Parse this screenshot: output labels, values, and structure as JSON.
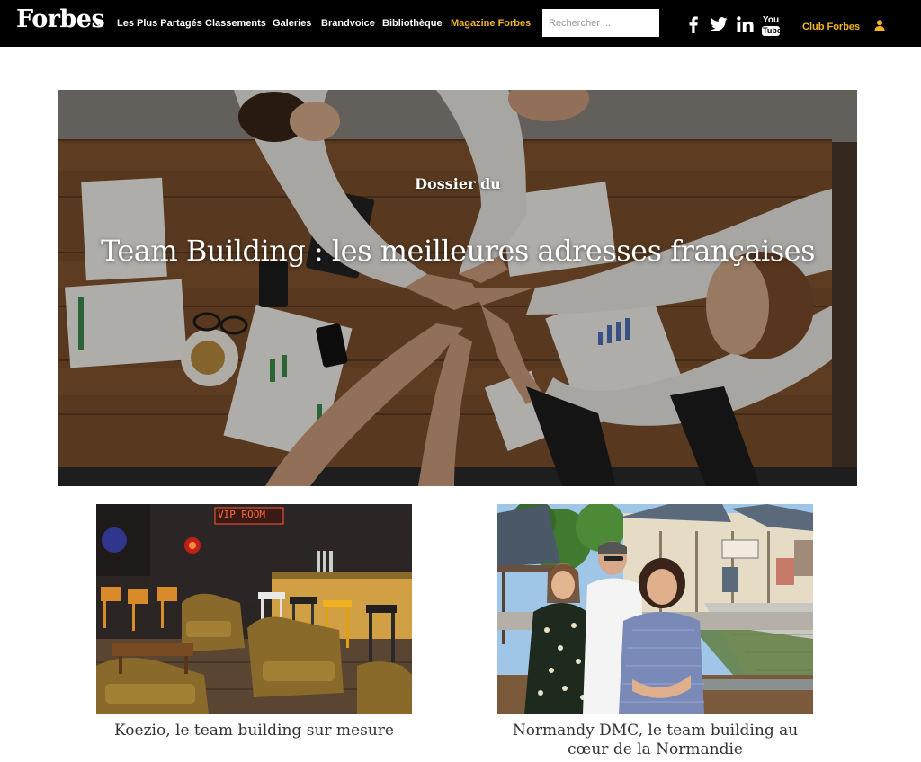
{
  "nav": {
    "logo": "Forbes",
    "items": [
      {
        "label": "Les Plus Partagés"
      },
      {
        "label": "Classements"
      },
      {
        "label": "Galeries"
      },
      {
        "label": "Brandvoice"
      },
      {
        "label": "Bibliothèque"
      },
      {
        "label": "Magazine Forbes"
      }
    ],
    "search_placeholder": "Rechercher ...",
    "youtube": {
      "you": "You",
      "tube": "Tube"
    },
    "club_label": "Club Forbes",
    "accent_color": "#f0b428"
  },
  "hero": {
    "kicker": "Dossier du",
    "title": "Team Building : les meilleures adresses françaises"
  },
  "cards": [
    {
      "title": "Koezio, le team building sur mesure",
      "sign": "VIP ROOM"
    },
    {
      "title": "Normandy DMC, le team building au cœur de la Normandie"
    }
  ]
}
